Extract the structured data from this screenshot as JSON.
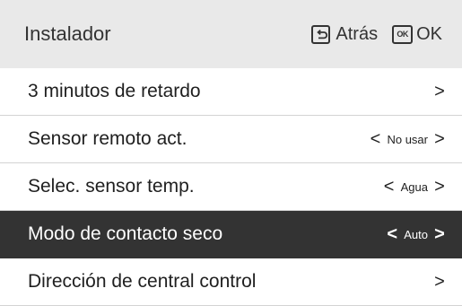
{
  "header": {
    "title": "Instalador",
    "back_label": "Atrás",
    "ok_icon_text": "OK",
    "ok_label": "OK",
    "icons": [
      "back-icon",
      "ok-icon"
    ]
  },
  "menu": {
    "items": [
      {
        "label": "3 minutos de retardo",
        "value": "",
        "has_left_arrow": false,
        "selected": false
      },
      {
        "label": "Sensor remoto act.",
        "value": "No usar",
        "has_left_arrow": true,
        "selected": false
      },
      {
        "label": "Selec. sensor temp.",
        "value": "Agua",
        "has_left_arrow": true,
        "selected": false
      },
      {
        "label": "Modo de contacto seco",
        "value": "Auto",
        "has_left_arrow": true,
        "selected": true
      },
      {
        "label": "Dirección de central control",
        "value": "",
        "has_left_arrow": false,
        "selected": false
      }
    ],
    "arrow_left": "<",
    "arrow_right": ">"
  },
  "colors": {
    "header_bg": "#e9e9e9",
    "selected_bg": "#333333",
    "text": "#1f1f1f",
    "divider": "#d3d3d3"
  }
}
